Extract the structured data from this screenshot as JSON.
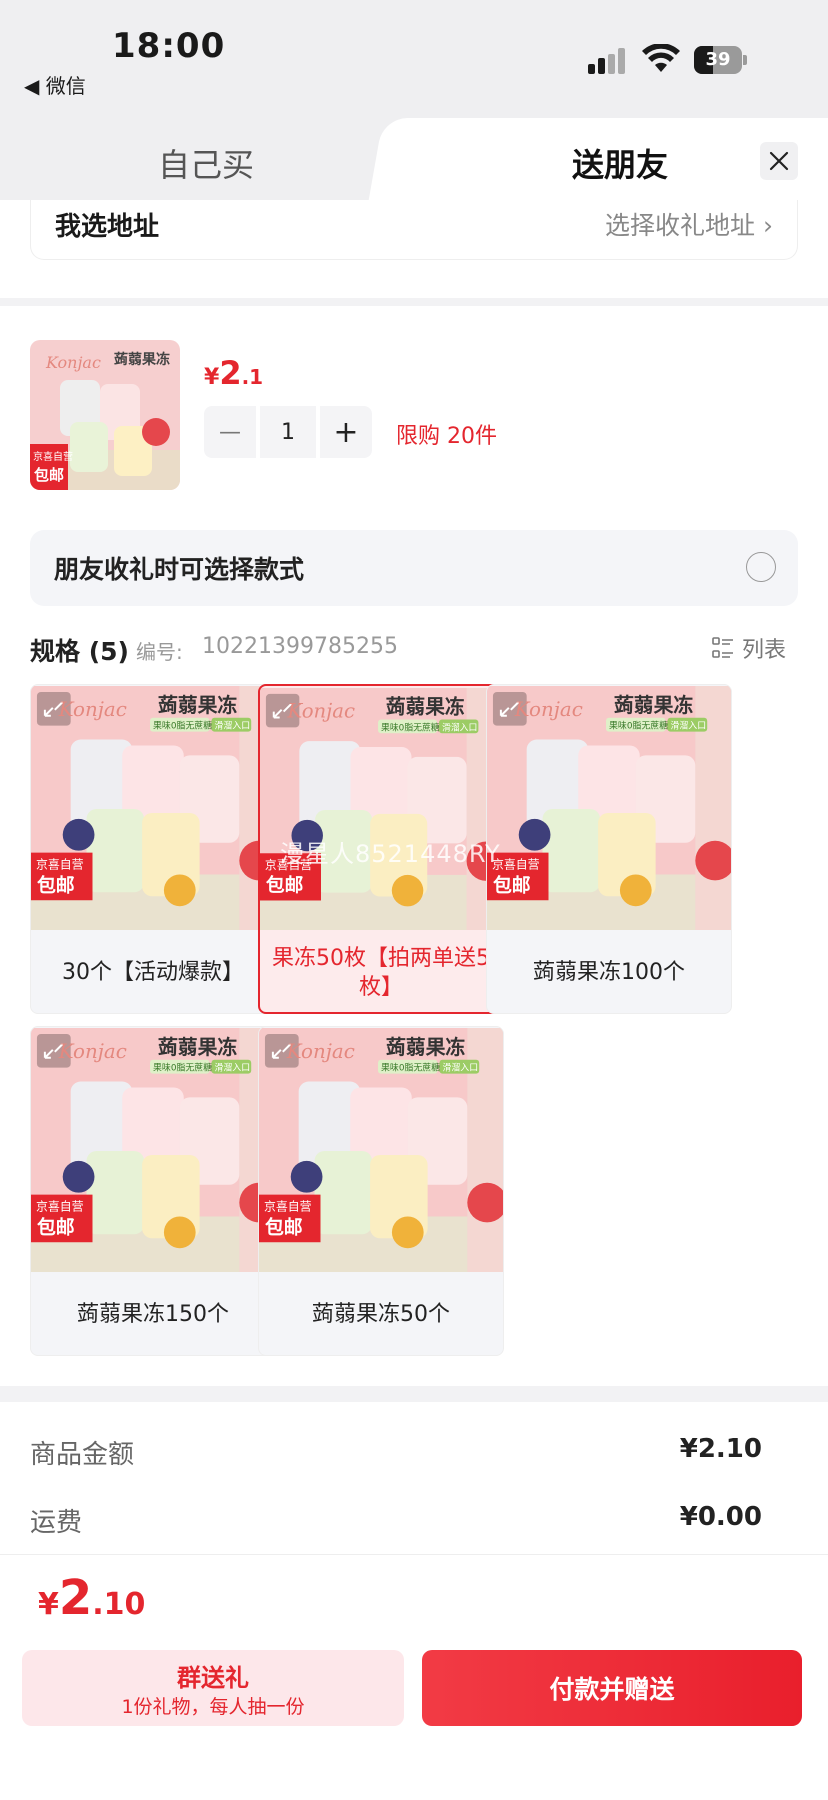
{
  "status": {
    "time": "18:00",
    "back_label": "◀ 微信",
    "battery": "39"
  },
  "tabs": {
    "buy_self": "自己买",
    "send_friend": "送朋友"
  },
  "address": {
    "title": "我选地址",
    "choose": "选择收礼地址"
  },
  "product": {
    "price_symbol": "¥",
    "price_int": "2",
    "price_dec": ".1",
    "quantity": "1",
    "limit": "限购 20件",
    "badge_top": "京喜自营",
    "badge_bottom": "包邮"
  },
  "friend_option": {
    "label": "朋友收礼时可选择款式"
  },
  "spec": {
    "title": "规格 (5)",
    "no_label": "编号:",
    "no": "10221399785255",
    "list_label": "列表"
  },
  "variants": [
    {
      "name": "30个【活动爆款】",
      "selected": false
    },
    {
      "name": "果冻50枚【拍两单送5枚】",
      "selected": true
    },
    {
      "name": "蒟蒻果冻100个",
      "selected": false
    },
    {
      "name": "蒟蒻果冻150个",
      "selected": false
    },
    {
      "name": "蒟蒻果冻50个",
      "selected": false
    }
  ],
  "pic": {
    "brand": "Konjac",
    "title": "蒟蒻果冻",
    "sub1": "果味0脂无蔗糖",
    "sub2": "滑溜入口",
    "badge_top": "京喜自营",
    "badge_bottom": "包邮"
  },
  "watermark": "漫星人8521448RY",
  "summary": {
    "goods_label": "商品金额",
    "goods_value": "¥2.10",
    "freight_label": "运费",
    "freight_value": "¥0.00",
    "total_symbol": "¥",
    "total_int": "2",
    "total_dec": ".10"
  },
  "buttons": {
    "group_title": "群送礼",
    "group_sub": "1份礼物，每人抽一份",
    "pay": "付款并赠送"
  },
  "colors": {
    "accent": "#e4262e",
    "pink_bg": "#f7c9c9"
  }
}
